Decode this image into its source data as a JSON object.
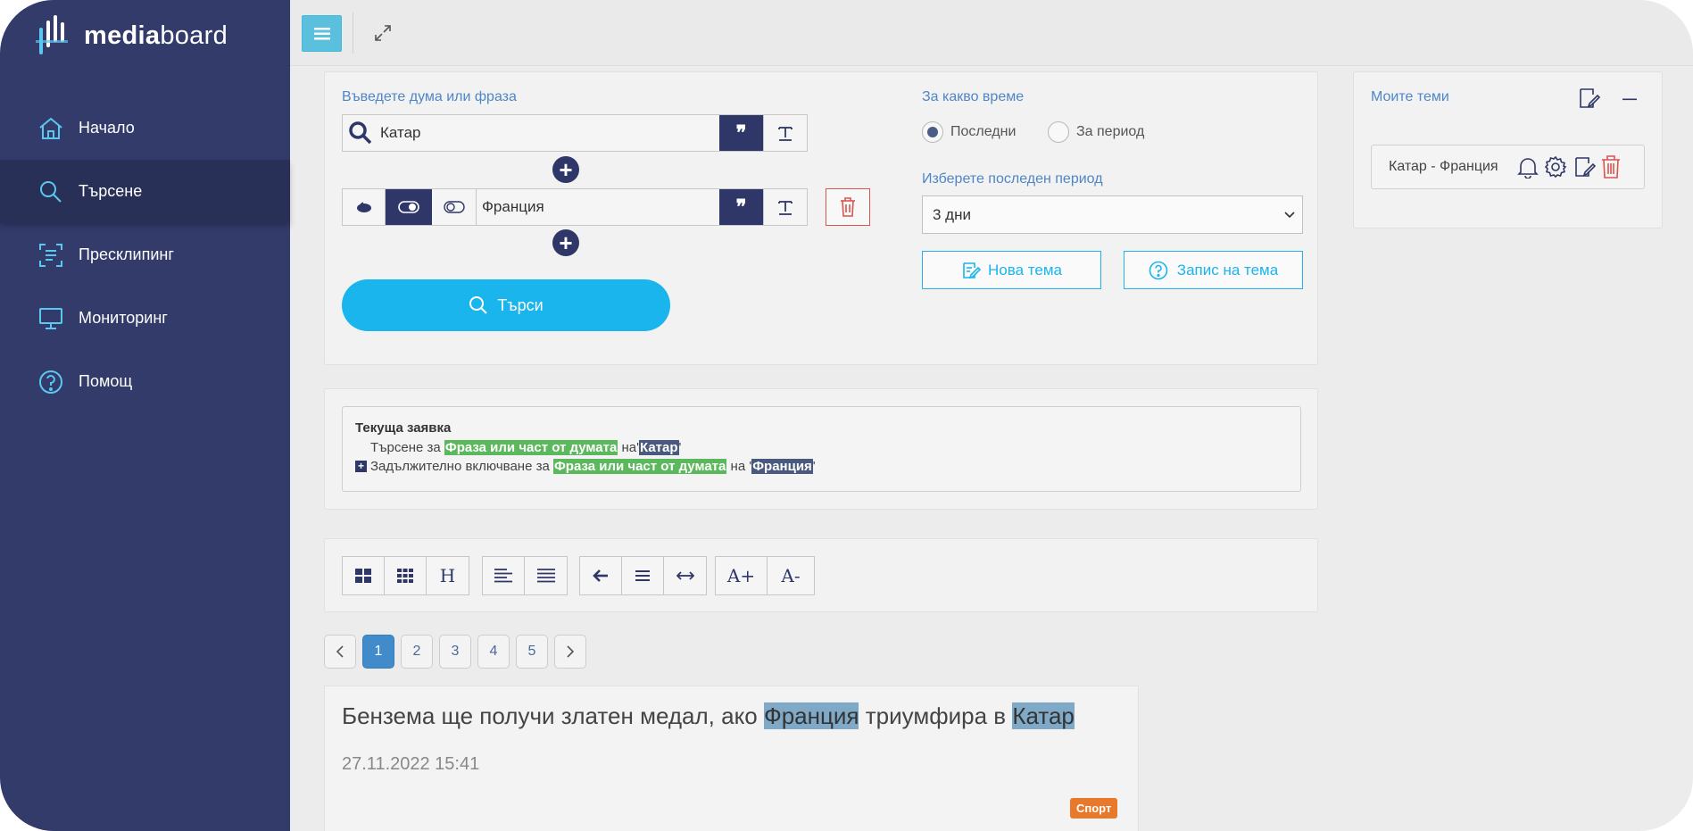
{
  "app": {
    "logo_text_bold": "media",
    "logo_text_light": "board"
  },
  "sidebar": {
    "items": [
      {
        "label": "Начало",
        "icon": "home-icon"
      },
      {
        "label": "Търсене",
        "icon": "search-icon",
        "active": true
      },
      {
        "label": "Пресклипинг",
        "icon": "scan-icon"
      },
      {
        "label": "Мониторинг",
        "icon": "monitor-icon"
      },
      {
        "label": "Помощ",
        "icon": "help-icon"
      }
    ]
  },
  "search": {
    "phrase_label": "Въведете дума или фраза",
    "term1": "Катар",
    "term2": "Франция",
    "quote_symbol": "❞",
    "search_button": "Търси"
  },
  "time": {
    "label": "За какво време",
    "option_last": "Последни",
    "option_period": "За период",
    "selected": "Последни",
    "period_label": "Изберете последен период",
    "period_value": "3 дни",
    "new_topic_button": "Нова тема",
    "save_topic_button": "Запис на тема"
  },
  "query": {
    "title": "Текуща заявка",
    "line1_prefix": "Търсене за",
    "line1_match": "Фраза или част от думата",
    "on": "на",
    "line1_term": "Катар",
    "line2_prefix": "Задължително включване за",
    "line2_match": "Фраза или част от думата",
    "line2_term": "Франция",
    "quote_open": "'",
    "quote_close": "'"
  },
  "toolbar": {
    "heading_tool": "H",
    "font_increase": "A+",
    "font_decrease": "A-"
  },
  "pagination": {
    "pages": [
      "1",
      "2",
      "3",
      "4",
      "5"
    ],
    "current": "1"
  },
  "article": {
    "title_part1": "Бензема ще получи златен медал, ако",
    "title_hl1": "Франция",
    "title_part2": "триумфира в",
    "title_hl2": "Катар",
    "date": "27.11.2022 15:41",
    "category": "Спорт"
  },
  "my_topics": {
    "title": "Моите теми",
    "items": [
      {
        "label": "Катар - Франция"
      }
    ]
  },
  "colors": {
    "sidebar": "#333b6b",
    "accent": "#1ab5ec",
    "dark_button": "#2e3768",
    "danger": "#d9534f",
    "highlight_green": "#5cb85c",
    "category_badge": "#e8782a"
  }
}
